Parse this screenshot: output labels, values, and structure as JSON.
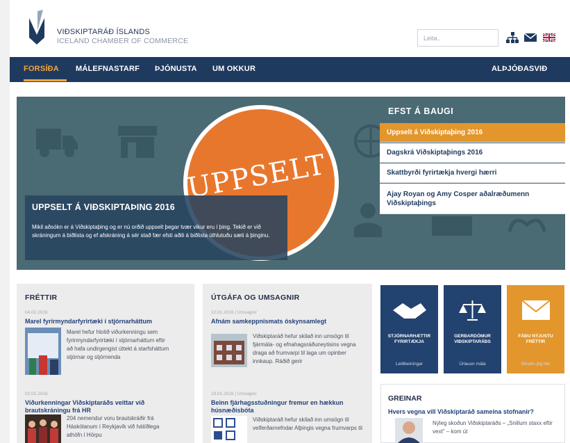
{
  "header": {
    "brand_line1": "VIÐSKIPTARÁÐ ÍSLANDS",
    "brand_line2": "ICELAND CHAMBER OF COMMERCE",
    "search_placeholder": "Leita..",
    "icons": [
      "sitemap-icon",
      "mail-icon",
      "uk-flag-icon"
    ]
  },
  "nav": {
    "items": [
      "FORSÍÐA",
      "MÁLEFNASTARF",
      "ÞJÓNUSTA",
      "UM OKKUR"
    ],
    "right_item": "ALÞJÓÐASVIÐ",
    "active": "FORSÍÐA"
  },
  "hero": {
    "stamp_text": "UPPSELT",
    "caption_title": "UPPSELT Á VIÐSKIPTAÞING 2016",
    "caption_text": "Mikil aðsókn er á Viðskiptaþing og er nú orðið uppselt þegar tvær vikur eru í þing. Tekið er við skráningum á biðlista og ef afskráning á sér stað fær efsti aðili á biðlista úthlutuðu sæti á þinginu.",
    "efst_title": "EFST Á BAUGI",
    "efst_items": [
      "Uppselt á Viðskiptaþing 2016",
      "Dagskrá Viðskiptaþings 2016",
      "Skattbyrði fyrirtækja hvergi hærri",
      "Ajay Royan og Amy Cosper aðalræðumenn Viðskiptaþings"
    ]
  },
  "frettir": {
    "title": "FRÉTTIR",
    "items": [
      {
        "date": "04.02.2016",
        "title": "Marel fyrirmyndarfyrirtæki í stjórnarháttum",
        "text": "Marel hefur hlotið viðurkenningu sem fyrirmyndarfyrirtæki í stjórnarháttum eftir að hafa undirgengist úttekt á starfsháttum stjórnar og stjórnenda"
      },
      {
        "date": "02.02.2016",
        "title": "Viðurkenningar Viðskiptaráðs veittar við brautskráningu frá HR",
        "text": "204 nemendur voru brautskráðir frá Háskólanum í Reykjavík við hátíðlega athöfn í Hörpu"
      }
    ]
  },
  "utgafa": {
    "title": "ÚTGÁFA OG UMSAGNIR",
    "items": [
      {
        "date": "22.01.2016 | Umsagnir",
        "title": "Afnám samkeppnismats óskynsamlegt",
        "text": "Viðskiptaráð hefur skilað inn umsögn til fjármála- og efnahagsráðuneytisins vegna draga að frumvarpi til laga um opinber innkaup. Ráðið gerir"
      },
      {
        "date": "19.01.2016 | Umsagnir",
        "title": "Beinn fjárhagsstuðningur fremur en hækkun húsnæðisbóta",
        "text": "Viðskiptaráð hefur skilað inn umsögn til velferðarnefndar Alþingis vegna frumvarps til"
      }
    ]
  },
  "tiles": [
    {
      "label": "STJÓRNARHÆTTIR FYRIRTÆKJA",
      "sub": "Leiðbeiningar",
      "color": "#22426f"
    },
    {
      "label": "GERÐARDÓMUR VIÐSKIPTARÁÐS",
      "sub": "Úrlausn mála",
      "color": "#22426f"
    },
    {
      "label": "FÁÐU NÝJUSTU FRÉTTIR",
      "sub": "Skráðu þig hér",
      "color": "#e3962b"
    }
  ],
  "greinar": {
    "title": "GREINAR",
    "item_title": "Hvers vegna vill Viðskiptaráð sameina stofnanir?",
    "item_text": "Nýleg skoðun Viðskiptaráðs – „Snillum staxx eftir vext\" – kom út"
  },
  "colors": {
    "navy": "#1f3a5f",
    "orange": "#e3962b",
    "hero": "#4a6a74",
    "stamp": "#e8772e"
  }
}
